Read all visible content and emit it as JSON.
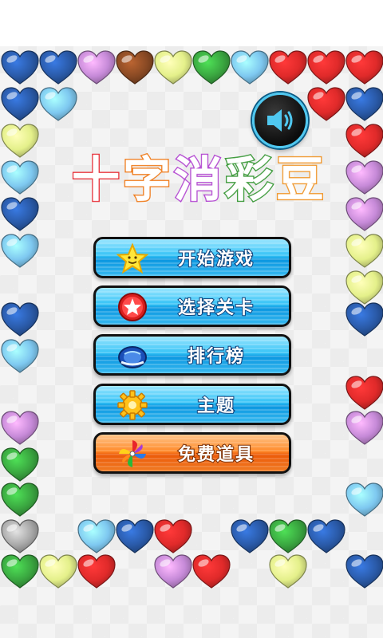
{
  "app": {
    "title_chars": [
      "十",
      "字",
      "消",
      "彩",
      "豆"
    ]
  },
  "sound": {
    "icon": "speaker-icon",
    "state": "on"
  },
  "menu": {
    "buttons": [
      {
        "id": "start",
        "label": "开始游戏",
        "icon": "star-icon",
        "color": "#34c3f6"
      },
      {
        "id": "select-level",
        "label": "选择关卡",
        "icon": "red-star-badge-icon",
        "color": "#34c3f6"
      },
      {
        "id": "leaderboard",
        "label": "排行榜",
        "icon": "globe-icon",
        "color": "#34c3f6"
      },
      {
        "id": "theme",
        "label": "主题",
        "icon": "gear-icon",
        "color": "#34c3f6"
      },
      {
        "id": "free-items",
        "label": "免费道具",
        "icon": "pinwheel-icon",
        "color": "#ff8a2a"
      }
    ]
  },
  "colors": {
    "navy": "#2a5aa8",
    "sky": "#7ec8f0",
    "violet": "#c68ad8",
    "brown": "#8a4a24",
    "lime": "#e4f08a",
    "green": "#3aa640",
    "red": "#e02a2a",
    "gray": "#a8a8a8"
  },
  "hearts": [
    "navy",
    "navy",
    "violet",
    "brown",
    "lime",
    "green",
    "sky",
    "red",
    "red",
    "red",
    "navy",
    "sky",
    "red",
    "navy",
    "lime",
    "red",
    "sky",
    "violet",
    "navy",
    "violet",
    "sky",
    "lime",
    "lime",
    "navy",
    "navy",
    "sky",
    "red",
    "violet",
    "violet",
    "green",
    "green",
    "sky",
    "gray",
    "sky",
    "navy",
    "red",
    "navy",
    "green",
    "navy",
    "green",
    "lime",
    "red",
    "violet",
    "red",
    "lime",
    "navy"
  ]
}
